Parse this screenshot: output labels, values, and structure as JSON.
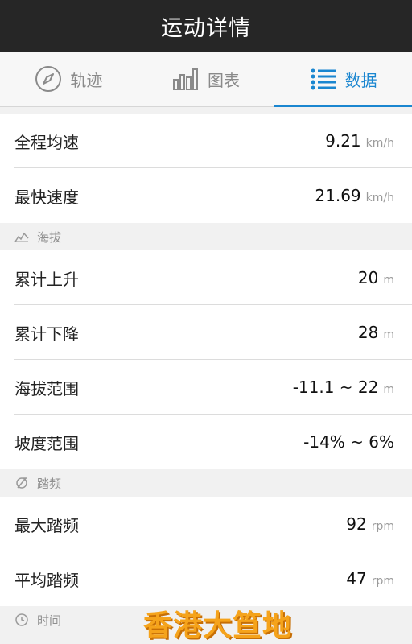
{
  "header": {
    "title": "运动详情"
  },
  "tabs": [
    {
      "label": "轨迹",
      "icon": "compass-icon",
      "active": false
    },
    {
      "label": "图表",
      "icon": "bar-chart-icon",
      "active": false
    },
    {
      "label": "数据",
      "icon": "list-icon",
      "active": true
    }
  ],
  "speed": {
    "rows": [
      {
        "label": "全程均速",
        "value": "9.21",
        "unit": "km/h"
      },
      {
        "label": "最快速度",
        "value": "21.69",
        "unit": "km/h"
      }
    ]
  },
  "altitude": {
    "title": "海拔",
    "icon": "altitude-icon",
    "rows": [
      {
        "label": "累计上升",
        "value": "20",
        "unit": "m"
      },
      {
        "label": "累计下降",
        "value": "28",
        "unit": "m"
      },
      {
        "label": "海拔范围",
        "value": "-11.1 ~ 22",
        "unit": "m"
      },
      {
        "label": "坡度范围",
        "value": "-14% ~ 6%",
        "unit": ""
      }
    ]
  },
  "cadence": {
    "title": "踏频",
    "icon": "cadence-icon",
    "rows": [
      {
        "label": "最大踏频",
        "value": "92",
        "unit": "rpm"
      },
      {
        "label": "平均踏频",
        "value": "47",
        "unit": "rpm"
      }
    ]
  },
  "time": {
    "title": "时间",
    "icon": "clock-icon"
  },
  "watermark": {
    "text": "香港大笪地"
  },
  "colors": {
    "accent": "#1a86d0",
    "header_bg": "#262626",
    "watermark": "#f5a31b"
  }
}
